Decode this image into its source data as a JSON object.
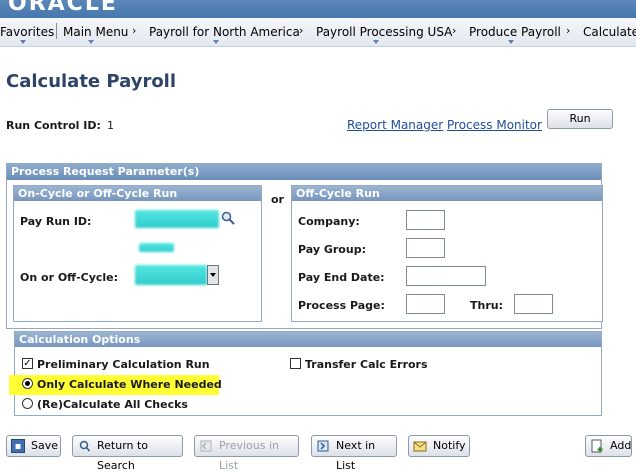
{
  "banner": {
    "logo_text": "ORACLE"
  },
  "nav": {
    "items": [
      "Favorites",
      "Main Menu",
      "Payroll for North America",
      "Payroll Processing USA",
      "Produce Payroll",
      "Calculate"
    ],
    "separator_glyph": "›"
  },
  "page": {
    "title": "Calculate Payroll"
  },
  "run_control": {
    "label": "Run Control ID:",
    "value": "1"
  },
  "links": {
    "report_manager": "Report Manager",
    "process_monitor": "Process Monitor"
  },
  "run_button": "Run",
  "process_request": {
    "title": "Process Request Parameter(s)",
    "on_off_cycle": {
      "title": "On-Cycle or Off-Cycle Run",
      "pay_run_id_label": "Pay Run ID:",
      "on_off_cycle_label": "On or Off-Cycle:"
    },
    "or_label": "or",
    "off_cycle": {
      "title": "Off-Cycle Run",
      "company_label": "Company:",
      "pay_group_label": "Pay Group:",
      "pay_end_date_label": "Pay End Date:",
      "process_page_label": "Process Page:",
      "thru_label": "Thru:"
    }
  },
  "calc_options": {
    "title": "Calculation Options",
    "preliminary": {
      "label": "Preliminary Calculation Run",
      "checked": true
    },
    "transfer_errors": {
      "label": "Transfer Calc Errors",
      "checked": false
    },
    "only_where_needed": {
      "label": "Only Calculate Where Needed",
      "selected": true
    },
    "recalculate_all": {
      "label": "(Re)Calculate All Checks",
      "selected": false
    },
    "highlight_color": "#ffff33"
  },
  "toolbar": {
    "save": "Save",
    "return_to_search": "Return to Search",
    "previous_in_list": "Previous in List",
    "next_in_list": "Next in List",
    "notify": "Notify",
    "add": "Add"
  },
  "icons": {
    "lookup": "magnifier-icon",
    "save": "save-icon",
    "return_to_search": "search-return-icon",
    "previous": "previous-icon",
    "next": "next-icon",
    "notify": "notify-icon",
    "add": "add-icon"
  },
  "colors": {
    "title": "#2e4466",
    "group_header": "#7796bd",
    "link": "#1f4d9a",
    "redacted": "#2fcccc"
  }
}
